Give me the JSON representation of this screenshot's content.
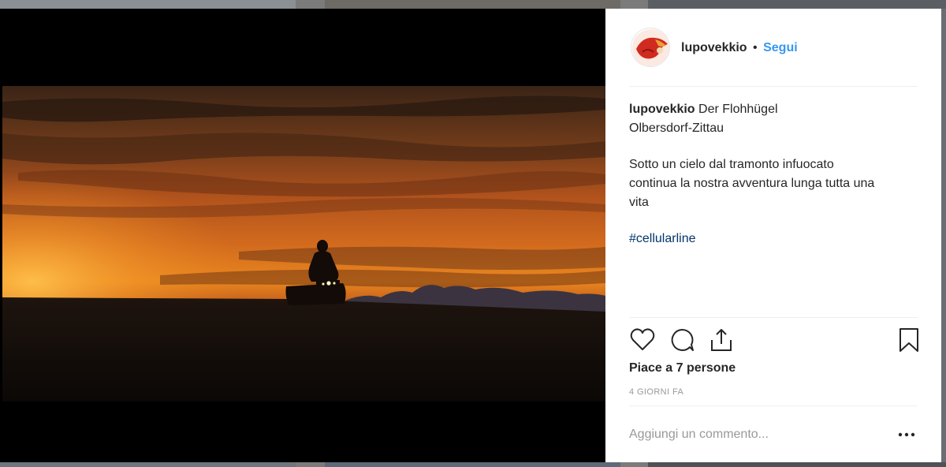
{
  "post": {
    "username": "lupovekkio",
    "separator": "•",
    "follow_label": "Segui",
    "caption_username": "lupovekkio",
    "caption_line1": "Der Flohhügel",
    "caption_line2": "Olbersdorf-Zittau",
    "body_line1": "Sotto un cielo dal tramonto infuocato",
    "body_line2": "continua la nostra avventura lunga tutta una",
    "body_line3": "vita",
    "hashtag": "#cellularline",
    "likes_text": "Piace a 7 persone",
    "time_ago": "4 GIORNI FA",
    "comment_placeholder": "Aggiungi un commento..."
  },
  "icons": {
    "like": "heart-icon",
    "comment": "comment-bubble-icon",
    "share": "share-icon",
    "save": "bookmark-icon",
    "more": "more-dots-icon"
  },
  "colors": {
    "link": "#3897f0",
    "hashtag": "#003569",
    "muted": "#999999",
    "text": "#262626"
  }
}
